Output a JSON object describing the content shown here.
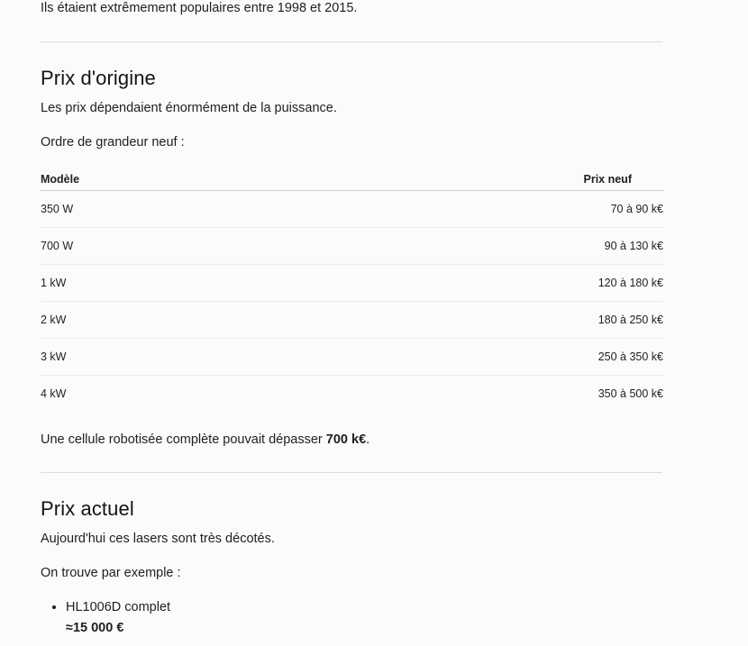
{
  "intro": "Ils étaient extrêmement populaires entre 1998 et 2015.",
  "section_original": {
    "title": "Prix d'origine",
    "lead": "Les prix dépendaient énormément de la puissance.",
    "order_label": "Ordre de grandeur neuf :",
    "table": {
      "headers": [
        "Modèle",
        "Prix neuf"
      ],
      "rows": [
        {
          "model": "350 W",
          "price": "70 à 90 k€"
        },
        {
          "model": "700 W",
          "price": "90 à 130 k€"
        },
        {
          "model": "1 kW",
          "price": "120 à 180 k€"
        },
        {
          "model": "2 kW",
          "price": "180 à 250 k€"
        },
        {
          "model": "3 kW",
          "price": "250 à 350 k€"
        },
        {
          "model": "4 kW",
          "price": "350 à 500 k€"
        }
      ]
    },
    "cell_note_prefix": "Une cellule robotisée complète pouvait dépasser ",
    "cell_note_value": "700 k€",
    "cell_note_suffix": "."
  },
  "section_current": {
    "title": "Prix actuel",
    "lead": "Aujourd'hui ces lasers sont très décotés.",
    "example_label": "On trouve par exemple :",
    "examples": [
      {
        "name": "HL1006D complet",
        "price": "≈15 000 €"
      }
    ]
  }
}
